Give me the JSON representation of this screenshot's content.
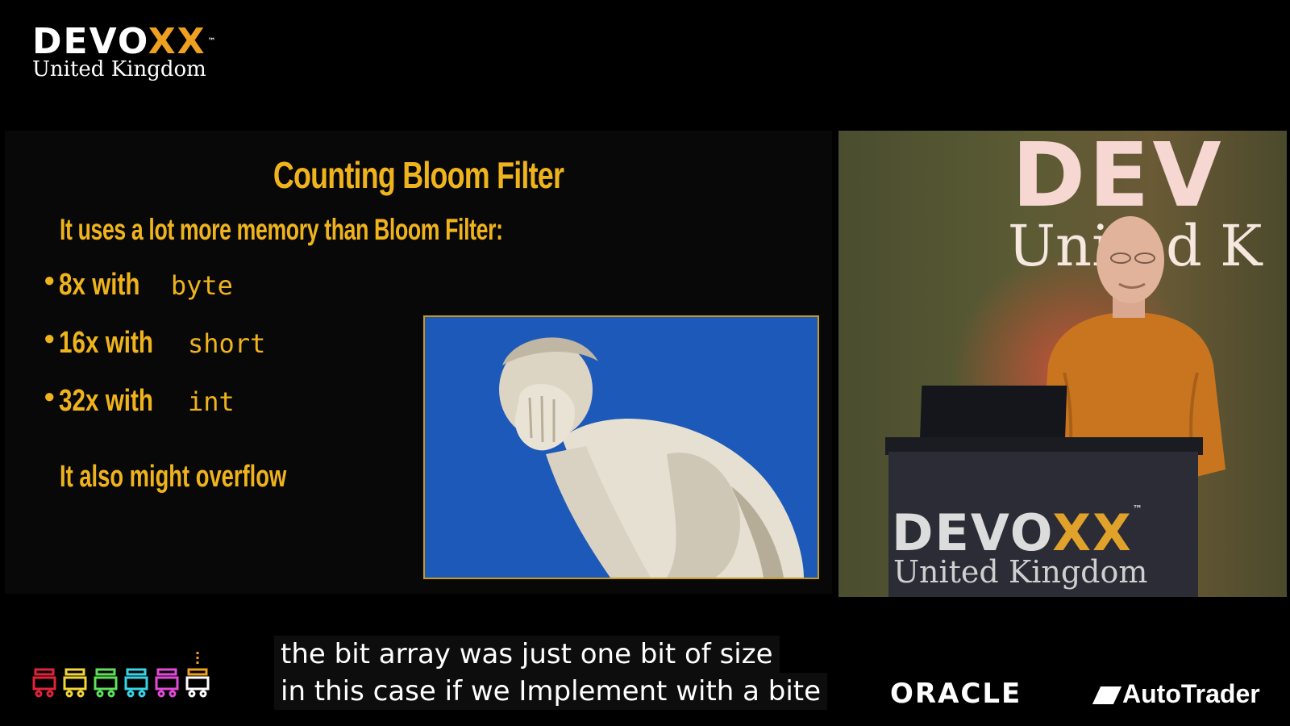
{
  "brand": {
    "word_main": "DEVO",
    "word_xx": "XX",
    "tm": "™",
    "subtitle": "United Kingdom"
  },
  "slide": {
    "title": "Counting Bloom Filter",
    "subtitle": "It uses a lot more memory than Bloom Filter:",
    "bullets": [
      {
        "text": "8x with",
        "code": "byte"
      },
      {
        "text": "16x with",
        "code": "short"
      },
      {
        "text": "32x with",
        "code": "int"
      }
    ],
    "note": "It also might overflow"
  },
  "camera": {
    "backdrop_word": "DEV",
    "backdrop_sub": "United K",
    "podium_word_main": "DEVO",
    "podium_word_xx": "XX",
    "podium_tm": "™",
    "podium_sub": "United Kingdom"
  },
  "captions": {
    "line1": "the bit array was just one bit of size",
    "line2": "in this case if we Implement with a bite"
  },
  "sponsors": {
    "oracle": "ORACLE",
    "autotrader": "AutoTrader"
  },
  "colors": {
    "slide_accent": "#efb31c",
    "brand_x": "#f0a020",
    "statue_bg": "#1d59b8"
  }
}
